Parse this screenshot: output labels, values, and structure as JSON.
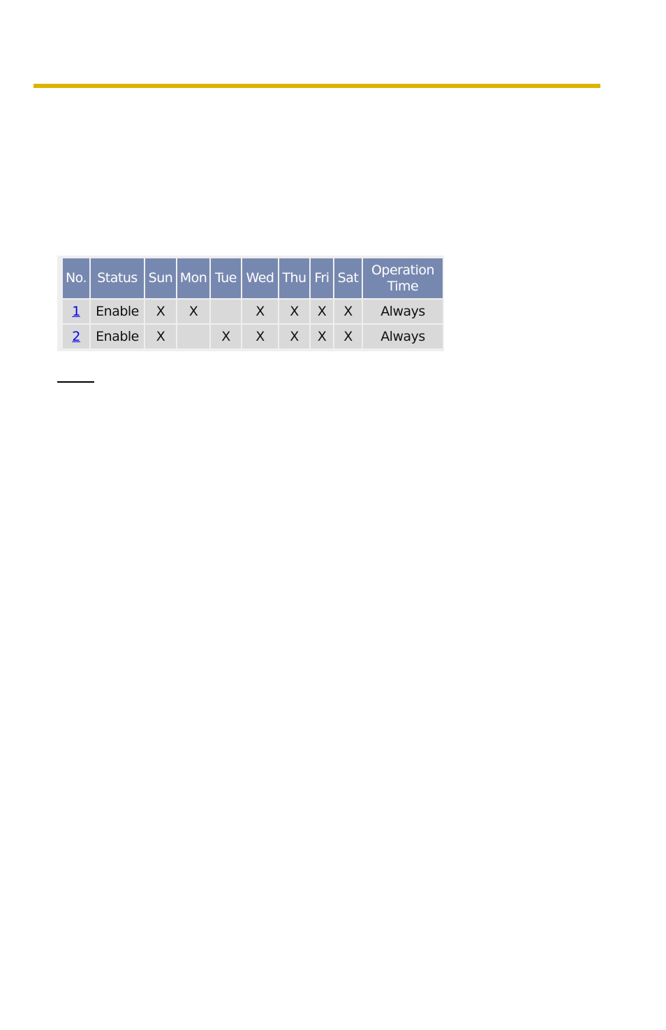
{
  "page": {
    "rule_color": "#dbb400"
  },
  "table": {
    "header_color": "#7788b0",
    "cell_color": "#d9d9d9",
    "columns": [
      "No.",
      "Status",
      "Sun",
      "Mon",
      "Tue",
      "Wed",
      "Thu",
      "Fri",
      "Sat",
      "Operation Time"
    ],
    "op_header_line1": "Operation",
    "op_header_line2": "Time",
    "rows": [
      {
        "no": "1",
        "status": "Enable",
        "sun": "X",
        "mon": "X",
        "tue": "",
        "wed": "X",
        "thu": "X",
        "fri": "X",
        "sat": "X",
        "operation_time": "Always"
      },
      {
        "no": "2",
        "status": "Enable",
        "sun": "X",
        "mon": "",
        "tue": "X",
        "wed": "X",
        "thu": "X",
        "fri": "X",
        "sat": "X",
        "operation_time": "Always"
      }
    ]
  }
}
